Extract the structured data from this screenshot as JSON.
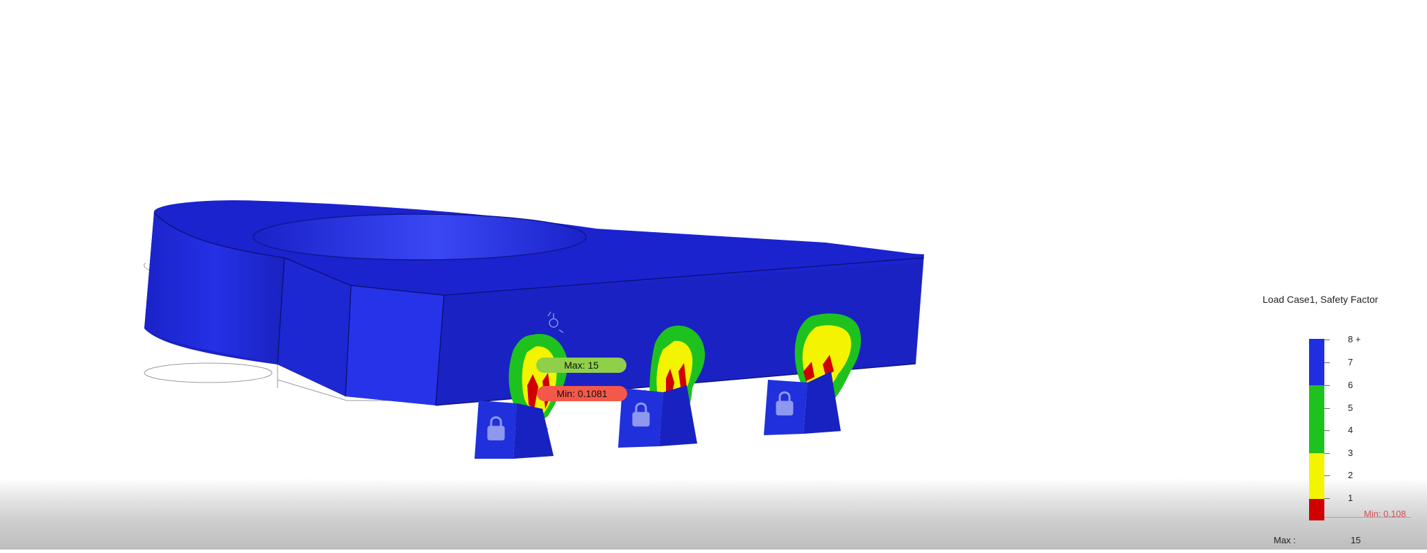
{
  "probes": {
    "max_label": "Max: 15",
    "min_label": "Min: 0.1081"
  },
  "legend": {
    "title": "Load Case1, Safety Factor",
    "ticks": [
      "8 +",
      "7",
      "6",
      "5",
      "4",
      "3",
      "2",
      "1"
    ],
    "min_label": "Min: 0.108",
    "max_caption": "Max :",
    "max_value": "15",
    "colors": {
      "blue": "#1f2ee0",
      "green": "#1ec21e",
      "yellow": "#f4f400",
      "red": "#d00000"
    }
  },
  "icons": [
    "lock-icon",
    "probe-icon"
  ]
}
